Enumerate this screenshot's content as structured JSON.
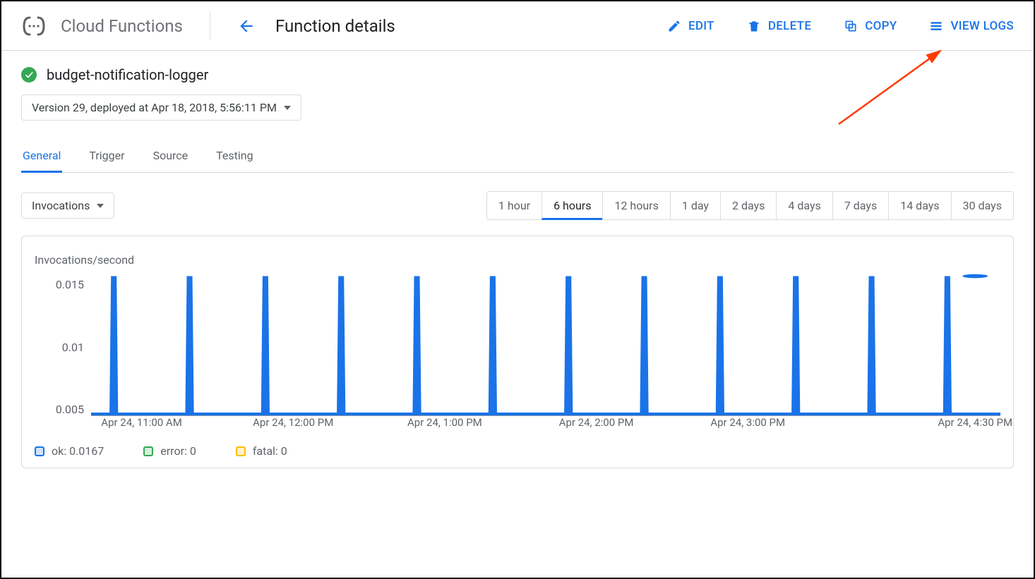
{
  "header": {
    "product_title": "Cloud Functions",
    "page_title": "Function details",
    "actions": {
      "edit": "EDIT",
      "delete": "DELETE",
      "copy": "COPY",
      "view_logs": "VIEW LOGS"
    }
  },
  "function": {
    "name": "budget-notification-logger",
    "status": "ok",
    "version_label": "Version 29, deployed at Apr 18, 2018, 5:56:11 PM"
  },
  "tabs": [
    "General",
    "Trigger",
    "Source",
    "Testing"
  ],
  "active_tab": "General",
  "metric_select": "Invocations",
  "time_ranges": [
    "1 hour",
    "6 hours",
    "12 hours",
    "1 day",
    "2 days",
    "4 days",
    "7 days",
    "14 days",
    "30 days"
  ],
  "active_range": "6 hours",
  "chart_data": {
    "type": "line",
    "title": "Invocations/second",
    "ylabel": "Invocations/second",
    "xlabel": "",
    "ylim": [
      0,
      0.017
    ],
    "yticks": [
      0.015,
      0.01,
      0.005
    ],
    "xticks": [
      "Apr 24, 11:00 AM",
      "Apr 24, 12:00 PM",
      "Apr 24, 1:00 PM",
      "Apr 24, 2:00 PM",
      "Apr 24, 3:00 PM",
      "Apr 24, 4:30 PM"
    ],
    "xtick_minutes": [
      0,
      60,
      120,
      180,
      240,
      330
    ],
    "x_range_minutes": [
      -20,
      340
    ],
    "series": [
      {
        "name": "ok",
        "color": "#1a73e8",
        "spike_minutes": [
          -11,
          19,
          49,
          79,
          109,
          139,
          169,
          199,
          229,
          259,
          289,
          319
        ],
        "spike_value": 0.0167
      },
      {
        "name": "error",
        "color": "#34a853",
        "spike_minutes": [],
        "spike_value": 0
      },
      {
        "name": "fatal",
        "color": "#fbbc04",
        "spike_minutes": [],
        "spike_value": 0
      }
    ],
    "hover_point": {
      "minute": 330,
      "value": 0.0167
    }
  },
  "legend": {
    "ok_label": "ok: 0.0167",
    "error_label": "error: 0",
    "fatal_label": "fatal: 0",
    "ok_color": "#1a73e8",
    "error_color": "#34a853",
    "fatal_color": "#fbbc04"
  },
  "annotation": {
    "points_to": "view_logs",
    "color": "#ff3b00"
  }
}
